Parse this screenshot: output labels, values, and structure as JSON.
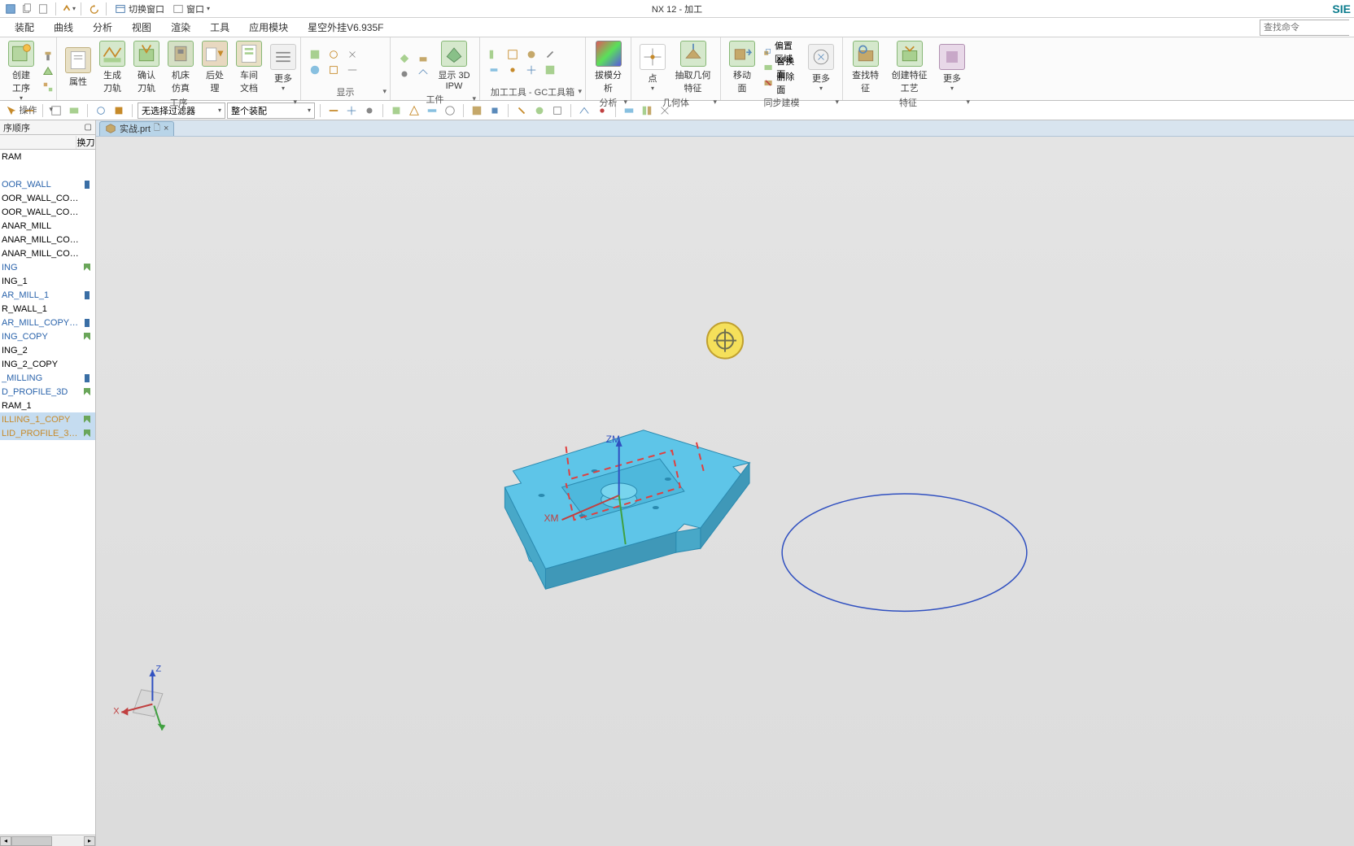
{
  "app": {
    "title": "NX 12 - 加工",
    "brand": "SIE"
  },
  "qat": {
    "switch_window": "切换窗口",
    "window_menu": "窗口"
  },
  "menu": [
    "装配",
    "曲线",
    "分析",
    "视图",
    "渲染",
    "工具",
    "应用模块",
    "星空外挂V6.935F"
  ],
  "search_placeholder": "查找命令",
  "ribbon": {
    "g1": {
      "btn1": "创建工序",
      "label": "操作"
    },
    "g2": {
      "props": "属性",
      "gen": "生成刀轨",
      "verify": "确认刀轨",
      "sim": "机床仿真",
      "post": "后处理",
      "shop": "车间文档",
      "more": "更多",
      "label": "工序"
    },
    "g3": {
      "ipw": "显示 3D IPW",
      "label": "显示"
    },
    "g4": {
      "label": "工件"
    },
    "g5": {
      "draft": "拔模分析",
      "label": "加工工具 - GC工具箱"
    },
    "g6": {
      "label": "分析"
    },
    "g7": {
      "point": "点",
      "extract": "抽取几何特征",
      "label": "几何体"
    },
    "g8": {
      "move": "移动面",
      "offset": "偏置区域",
      "replace": "替换面",
      "delete": "删除面",
      "more": "更多",
      "label": "同步建模"
    },
    "g9": {
      "find": "查找特征",
      "create": "创建特征工艺",
      "more": "更多",
      "label": "特征"
    }
  },
  "filter1": "无选择过滤器",
  "filter2": "整个装配",
  "left": {
    "title": "序顺序",
    "col2": "换刀",
    "items": [
      {
        "text": "RAM",
        "cls": "",
        "mark": ""
      },
      {
        "text": "",
        "cls": "",
        "mark": ""
      },
      {
        "text": "OOR_WALL",
        "cls": "blue",
        "mark": "bar"
      },
      {
        "text": "OOR_WALL_COPY",
        "cls": "",
        "mark": ""
      },
      {
        "text": "OOR_WALL_COP...",
        "cls": "",
        "mark": ""
      },
      {
        "text": "ANAR_MILL",
        "cls": "",
        "mark": ""
      },
      {
        "text": "ANAR_MILL_COPY",
        "cls": "",
        "mark": ""
      },
      {
        "text": "ANAR_MILL_COP...",
        "cls": "",
        "mark": ""
      },
      {
        "text": "ING",
        "cls": "blue",
        "mark": "slash"
      },
      {
        "text": "ING_1",
        "cls": "",
        "mark": ""
      },
      {
        "text": "AR_MILL_1",
        "cls": "blue",
        "mark": "bar"
      },
      {
        "text": "R_WALL_1",
        "cls": "",
        "mark": ""
      },
      {
        "text": "AR_MILL_COPY_C...",
        "cls": "blue",
        "mark": "bar"
      },
      {
        "text": "ING_COPY",
        "cls": "blue",
        "mark": "slash"
      },
      {
        "text": "ING_2",
        "cls": "",
        "mark": ""
      },
      {
        "text": "ING_2_COPY",
        "cls": "",
        "mark": ""
      },
      {
        "text": "_MILLING",
        "cls": "blue",
        "mark": "bar"
      },
      {
        "text": "D_PROFILE_3D",
        "cls": "blue",
        "mark": "slash"
      },
      {
        "text": "RAM_1",
        "cls": "",
        "mark": ""
      },
      {
        "text": "ILLING_1_COPY",
        "cls": "orange",
        "mark": "slash",
        "sel": true
      },
      {
        "text": "LID_PROFILE_3D...",
        "cls": "orange",
        "mark": "slash",
        "sel": true
      }
    ]
  },
  "file_tab": {
    "name": "实战.prt",
    "dirty": "🗋"
  },
  "axes": {
    "zm": "ZM",
    "xm": "XM",
    "z": "Z",
    "x": "X"
  }
}
